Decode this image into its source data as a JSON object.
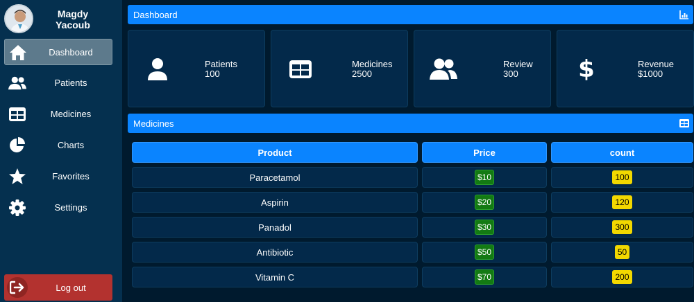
{
  "profile": {
    "name": "Magdy Yacoub"
  },
  "sidebar": {
    "items": [
      {
        "label": "Dashboard",
        "icon": "home-icon",
        "active": true
      },
      {
        "label": "Patients",
        "icon": "users-icon"
      },
      {
        "label": "Medicines",
        "icon": "table-icon"
      },
      {
        "label": "Charts",
        "icon": "pie-chart-icon"
      },
      {
        "label": "Favorites",
        "icon": "star-icon"
      },
      {
        "label": "Settings",
        "icon": "gear-icon"
      }
    ],
    "logout": {
      "label": "Log out",
      "icon": "logout-icon"
    }
  },
  "dashboard": {
    "title": "Dashboard",
    "icon": "bar-chart-icon",
    "cards": [
      {
        "label": "Patients",
        "value": "100",
        "icon": "user-icon"
      },
      {
        "label": "Medicines",
        "value": "2500",
        "icon": "table-icon"
      },
      {
        "label": "Review",
        "value": "300",
        "icon": "users-icon"
      },
      {
        "label": "Revenue",
        "value": "$1000",
        "icon": "dollar-icon"
      }
    ]
  },
  "medicines": {
    "title": "Medicines",
    "icon": "table-icon",
    "columns": [
      "Product",
      "Price",
      "count"
    ],
    "rows": [
      {
        "product": "Paracetamol",
        "price": "$10",
        "count": "100"
      },
      {
        "product": "Aspirin",
        "price": "$20",
        "count": "120"
      },
      {
        "product": "Panadol",
        "price": "$30",
        "count": "300"
      },
      {
        "product": "Antibiotic",
        "price": "$50",
        "count": "50"
      },
      {
        "product": "Vitamin C",
        "price": "$70",
        "count": "200"
      }
    ]
  },
  "colors": {
    "sidebar": "#05304f",
    "background": "#001a2e",
    "accent": "#0a84ff",
    "card": "#03294a",
    "active_item": "#5d7a8c",
    "logout": "#b3322f",
    "price_badge": "#137a13",
    "count_badge": "#f2d800"
  }
}
